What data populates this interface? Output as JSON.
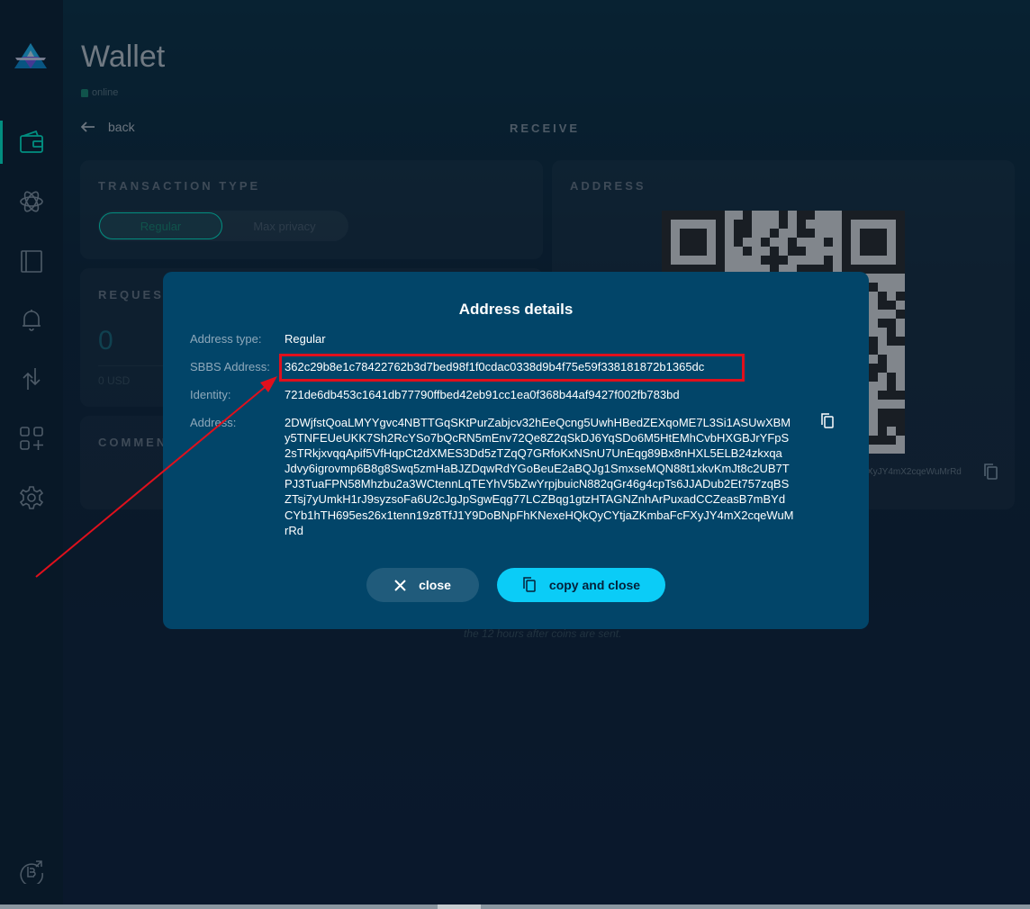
{
  "colors": {
    "accent": "#00f6d2",
    "modal_bg": "#024569",
    "primary_button": "#0bccf7",
    "annotation_red": "#e0101c"
  },
  "sidebar": {
    "items": [
      {
        "icon": "wallet-icon",
        "active": true
      },
      {
        "icon": "atom-icon",
        "active": false
      },
      {
        "icon": "address-book-icon",
        "active": false
      },
      {
        "icon": "bell-icon",
        "active": false
      },
      {
        "icon": "transfer-arrows-icon",
        "active": false
      },
      {
        "icon": "apps-grid-icon",
        "active": false
      },
      {
        "icon": "gear-icon",
        "active": false
      }
    ],
    "bottom_icon": "beam-external-icon"
  },
  "header": {
    "title": "Wallet",
    "status": "online",
    "back_label": "back",
    "page_subtitle": "RECEIVE"
  },
  "transaction_type": {
    "label": "TRANSACTION TYPE",
    "options": [
      "Regular",
      "Max privacy"
    ],
    "selected": "Regular"
  },
  "request": {
    "label": "REQUES",
    "amount": "0",
    "usd": "0 USD"
  },
  "comment": {
    "label": "COMMEN"
  },
  "address_panel": {
    "label": "ADDRESS",
    "address_tail": "XyJY4mX2cqeWuMrRd"
  },
  "hint_text": "the 12 hours after coins are sent.",
  "modal": {
    "title": "Address details",
    "rows": [
      {
        "label": "Address type:",
        "value": "Regular"
      },
      {
        "label": "SBBS Address:",
        "value": "362c29b8e1c78422762b3d7bed98f1f0cdac0338d9b4f75e59f338181872b1365dc"
      },
      {
        "label": "Identity:",
        "value": "721de6db453c1641db77790ffbed42eb91cc1ea0f368b44af9427f002fb783bd"
      },
      {
        "label": "Address:",
        "value": ""
      }
    ],
    "address_lines": [
      "2DWjfstQoaLMYYgvc4NBTTGqSKtPurZabjcv32hEeQcng5UwhHBedZEXqoME7L3Si1ASUwXBM",
      "y5TNFEUeUKK7Sh2RcYSo7bQcRN5mEnv72Qe8Z2qSkDJ6YqSDo6M5HtEMhCvbHXGBJrYFpS",
      "2sTRkjxvqqApif5VfHqpCt2dXMES3Dd5zTZqQ7GRfoKxNSnU7UnEqg89Bx8nHXL5ELB24zkxqa",
      "Jdvy6igrovmp6B8g8Swq5zmHaBJZDqwRdYGoBeuE2aBQJg1SmxseMQN88t1xkvKmJt8c2UB7T",
      "PJ3TuaFPN58Mhzbu2a3WCtennLqTEYhV5bZwYrpjbuicN882qGr46g4cpTs6JJADub2Et757zqBS",
      "ZTsj7yUmkH1rJ9syzsoFa6U2cJgJpSgwEqg77LCZBqg1gtzHTAGNZnhArPuxadCCZeasB7mBYd",
      "CYb1hTH695es26x1tenn19z8TfJ1Y9DoBNpFhKNexeHQkQyCYtjaZKmbaFcFXyJY4mX2cqeWuM",
      "rRd"
    ],
    "close_label": "close",
    "copy_close_label": "copy and close"
  }
}
